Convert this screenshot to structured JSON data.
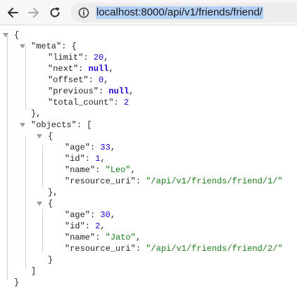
{
  "browser": {
    "url": "localhost:8000/api/v1/friends/friend/",
    "icons": {
      "back": "back-arrow-icon",
      "forward": "forward-arrow-icon",
      "reload": "reload-icon",
      "site_info": "info-icon"
    }
  },
  "json": {
    "meta_key": "\"meta\"",
    "meta": {
      "limit_key": "\"limit\"",
      "limit": "20",
      "next_key": "\"next\"",
      "next": "null",
      "offset_key": "\"offset\"",
      "offset": "0",
      "previous_key": "\"previous\"",
      "previous": "null",
      "total_count_key": "\"total_count\"",
      "total_count": "2"
    },
    "objects_key": "\"objects\"",
    "objects": [
      {
        "age_key": "\"age\"",
        "age": "33",
        "id_key": "\"id\"",
        "id": "1",
        "name_key": "\"name\"",
        "name": "\"Leo\"",
        "resource_uri_key": "\"resource_uri\"",
        "resource_uri": "\"/api/v1/friends/friend/1/\""
      },
      {
        "age_key": "\"age\"",
        "age": "30",
        "id_key": "\"id\"",
        "id": "2",
        "name_key": "\"name\"",
        "name": "\"Jato\"",
        "resource_uri_key": "\"resource_uri\"",
        "resource_uri": "\"/api/v1/friends/friend/2/\""
      }
    ]
  }
}
